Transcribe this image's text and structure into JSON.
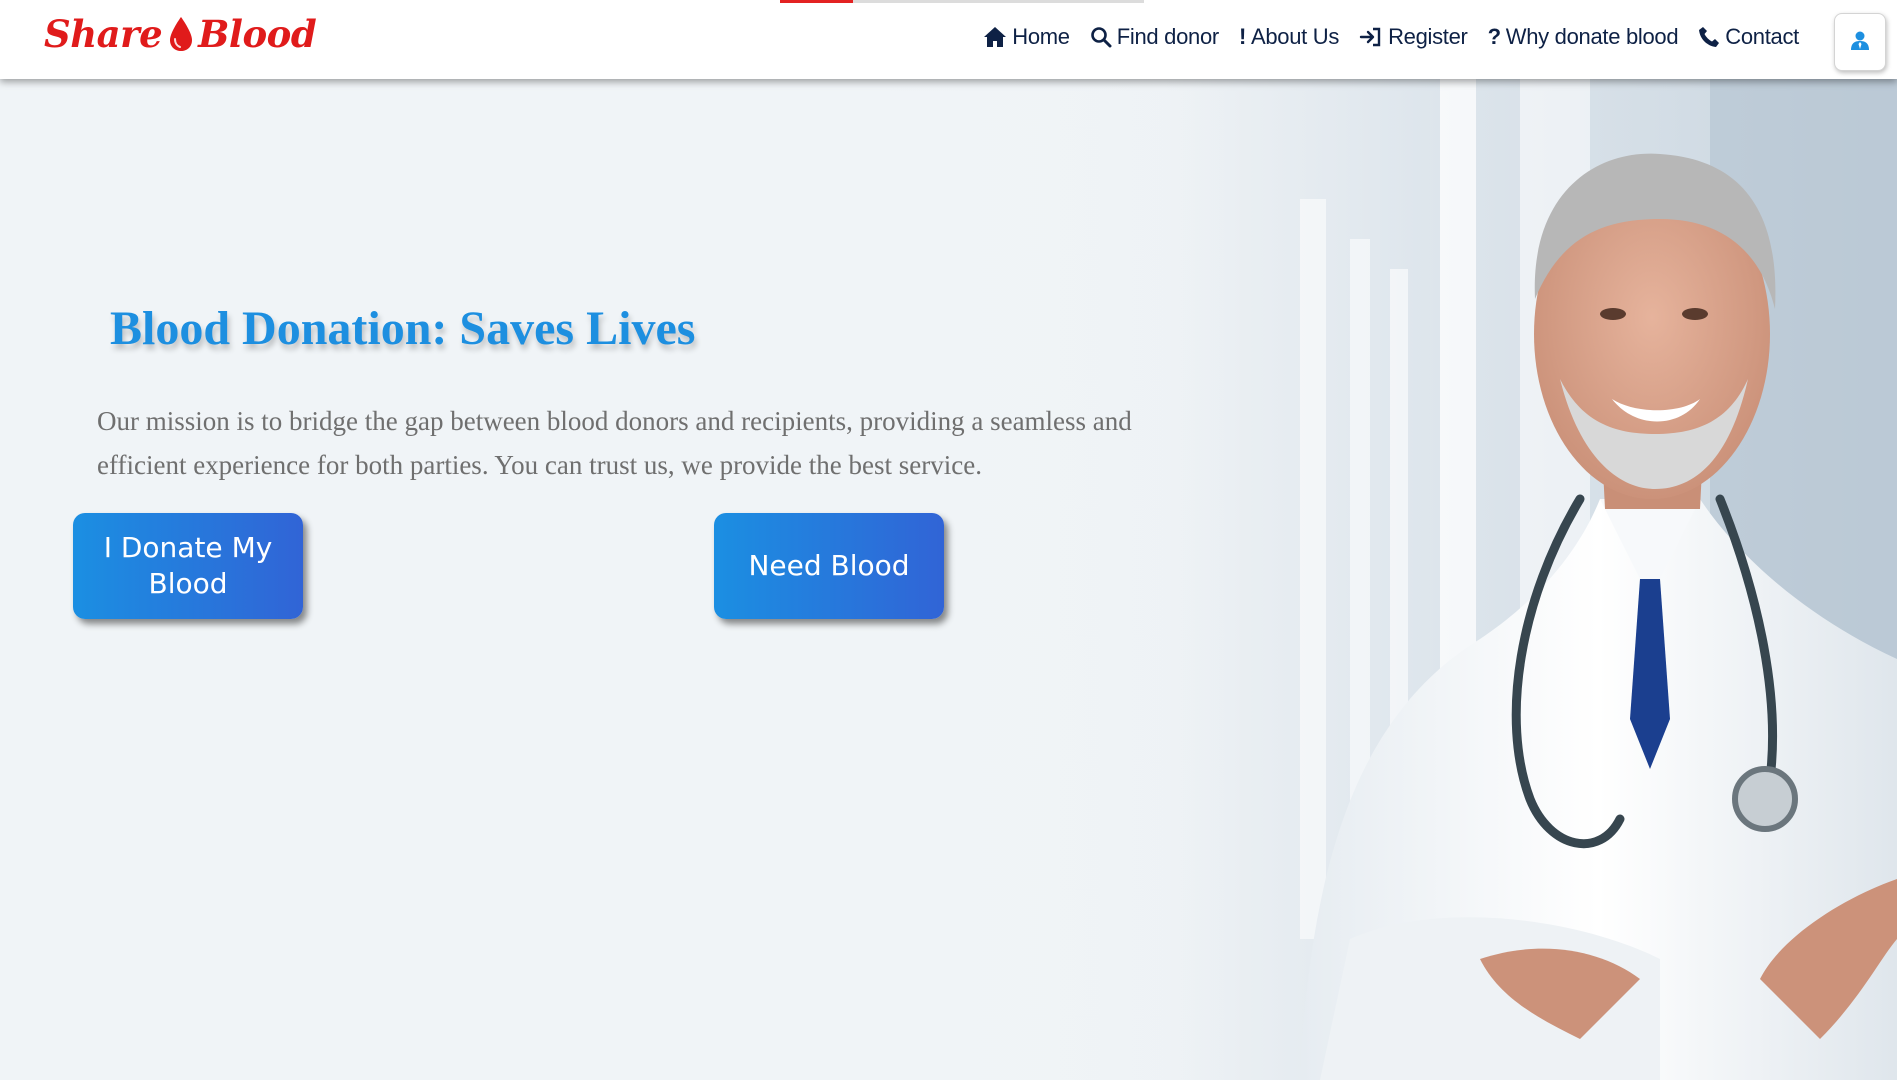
{
  "brand": {
    "part1": "Share",
    "part2": "Blood",
    "color": "#e01b1b"
  },
  "progress": {
    "fraction": 0.2,
    "track_color": "#dcdcdc",
    "fill_color": "#e32222"
  },
  "nav": {
    "items": [
      {
        "label": "Home",
        "icon": "home-icon"
      },
      {
        "label": "Find donor",
        "icon": "search-icon"
      },
      {
        "label": "About Us",
        "icon": "exclamation-icon"
      },
      {
        "label": "Register",
        "icon": "sign-in-icon"
      },
      {
        "label": "Why donate blood",
        "icon": "question-icon"
      },
      {
        "label": "Contact",
        "icon": "phone-icon"
      }
    ],
    "text_color": "#0e2145"
  },
  "user_button": {
    "icon": "user-icon",
    "color": "#1d8fe0"
  },
  "hero": {
    "title": "Blood Donation: Saves Lives",
    "text": "Our mission is to bridge the gap between blood donors and recipients, providing a seamless and efficient experience for both parties. You can trust us, we provide the best service.",
    "donate_button": "I Donate My Blood",
    "need_button": "Need Blood",
    "title_color": "#1d8fe0",
    "button_gradient": [
      "#1b8fe2",
      "#3164d6"
    ],
    "image": "doctor-photo"
  }
}
